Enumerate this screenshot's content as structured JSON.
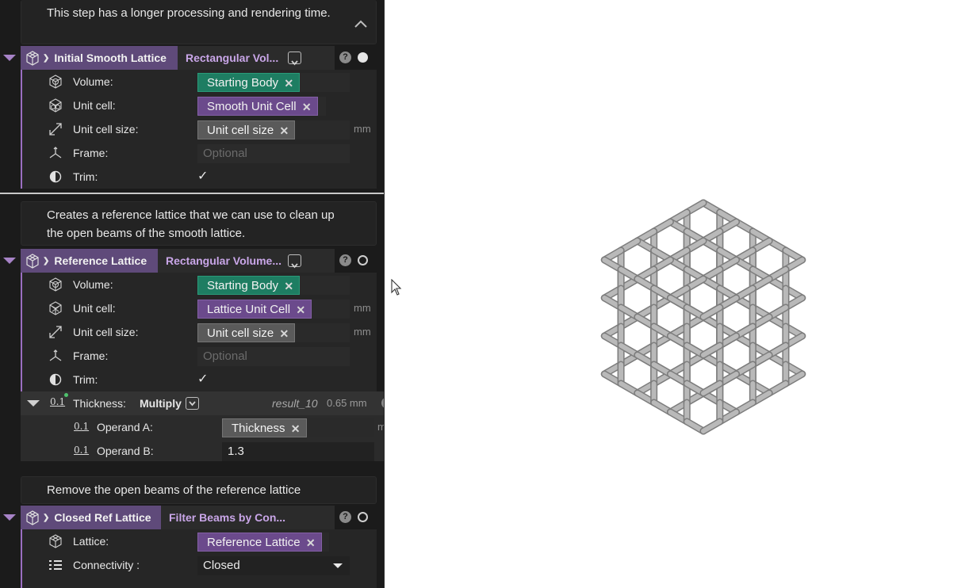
{
  "blocks": [
    {
      "comment": "This step has a longer processing and rendering time.",
      "name": "Initial Smooth Lattice",
      "type": "Rectangular Vol...",
      "help": "?",
      "status": "filled",
      "rows": {
        "volume": {
          "label": "Volume:",
          "value": "Starting Body"
        },
        "unit_cell": {
          "label": "Unit cell:",
          "value": "Smooth Unit Cell"
        },
        "unit_cell_size": {
          "label": "Unit cell size:",
          "value": "Unit cell size",
          "unit": "mm"
        },
        "frame": {
          "label": "Frame:",
          "placeholder": "Optional"
        },
        "trim": {
          "label": "Trim:",
          "checked": "✓"
        }
      }
    },
    {
      "comment": "Creates a reference lattice that we can use to clean up the open beams of the smooth lattice.",
      "name": "Reference Lattice",
      "type": "Rectangular Volume...",
      "help": "?",
      "status": "hollow",
      "rows": {
        "volume": {
          "label": "Volume:",
          "value": "Starting Body"
        },
        "unit_cell": {
          "label": "Unit cell:",
          "value": "Lattice Unit Cell",
          "unit": "mm"
        },
        "unit_cell_size": {
          "label": "Unit cell size:",
          "value": "Unit cell size",
          "unit": "mm"
        },
        "frame": {
          "label": "Frame:",
          "placeholder": "Optional"
        },
        "trim": {
          "label": "Trim:",
          "checked": "✓"
        }
      },
      "thickness": {
        "icon_text": "0.1",
        "label": "Thickness:",
        "operation": "Multiply",
        "result_name": "result_10",
        "result_value": "0.65 mm",
        "help": "?",
        "operand_a": {
          "label": "Operand A:",
          "value": "Thickness",
          "unit": "mm"
        },
        "operand_b": {
          "label": "Operand B:",
          "value": "1.3"
        }
      }
    },
    {
      "comment": "Remove the open beams of the reference lattice",
      "name": "Closed Ref Lattice",
      "type": "Filter Beams by Con...",
      "help": "?",
      "status": "hollow",
      "rows": {
        "lattice": {
          "label": "Lattice:",
          "value": "Reference Lattice"
        },
        "connectivity": {
          "label": "Connectivity :",
          "value": "Closed"
        }
      }
    }
  ],
  "chip_close": "✕",
  "viewport": {
    "model": "lattice-cube",
    "background": "#ffffff",
    "beam_color": "#b9b9b9"
  },
  "colors": {
    "accent": "#9b6fc1",
    "green_chip": "#1e7d62",
    "purple_chip": "#6b4a8c",
    "gray_chip": "#5a5a5a"
  }
}
